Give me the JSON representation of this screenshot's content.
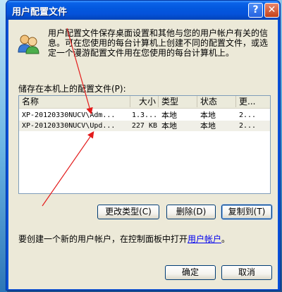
{
  "window": {
    "title": "用户配置文件"
  },
  "titlebar_buttons": {
    "help": "?",
    "close": "✕"
  },
  "intro_text": "用户配置文件保存桌面设置和其他与您的用户帐户有关的信息。可在您使用的每台计算机上创建不同的配置文件，或选定一个漫游配置文件用在您使用的每台计算机上。",
  "stored_label": "储存在本机上的配置文件(P):",
  "table": {
    "columns": [
      "名称",
      "大小",
      "类型",
      "状态",
      "更..."
    ],
    "rows": [
      {
        "name": "XP-20120330NUCV\\Adm...",
        "size": "1.3...",
        "type": "本地",
        "status": "本地",
        "modified": "2..."
      },
      {
        "name": "XP-20120330NUCV\\Upd...",
        "size": "227 KB",
        "type": "本地",
        "status": "本地",
        "modified": "2..."
      }
    ]
  },
  "buttons": {
    "change_type": "更改类型(C)",
    "delete": "删除(D)",
    "copy_to": "复制到(T)",
    "ok": "确定",
    "cancel": "取消"
  },
  "footer": {
    "text_before": "要创建一个新的用户帐户，在控制面板中打开",
    "link": "用户帐户",
    "text_after": "。"
  },
  "colors": {
    "titlebar": "#0358de",
    "dialog_bg": "#ece9d8",
    "annotation_arrow": "#e31b1b"
  }
}
